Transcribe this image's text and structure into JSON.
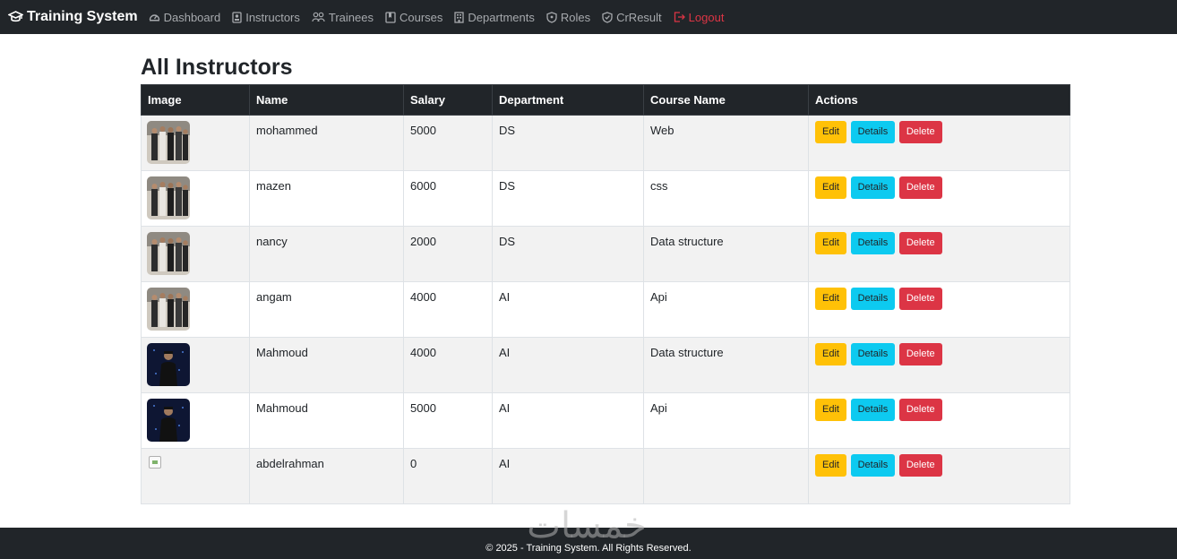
{
  "navbar": {
    "brand": "Training System",
    "items": [
      {
        "label": "Dashboard",
        "icon": "speedometer-icon"
      },
      {
        "label": "Instructors",
        "icon": "id-card-icon"
      },
      {
        "label": "Trainees",
        "icon": "people-icon"
      },
      {
        "label": "Courses",
        "icon": "book-icon"
      },
      {
        "label": "Departments",
        "icon": "building-icon"
      },
      {
        "label": "Roles",
        "icon": "shield-icon"
      },
      {
        "label": "CrResult",
        "icon": "shield-check-icon"
      },
      {
        "label": "Logout",
        "icon": "logout-icon"
      }
    ],
    "colors": {
      "background": "#212529",
      "link": "#a6a9ad",
      "logout": "#dc3545"
    }
  },
  "page": {
    "title": "All Instructors"
  },
  "table": {
    "headers": [
      "Image",
      "Name",
      "Salary",
      "Department",
      "Course Name",
      "Actions"
    ],
    "rows": [
      {
        "image": "group-photo",
        "name": "mohammed",
        "salary": "5000",
        "department": "DS",
        "course": "Web"
      },
      {
        "image": "group-photo",
        "name": "mazen",
        "salary": "6000",
        "department": "DS",
        "course": "css"
      },
      {
        "image": "group-photo",
        "name": "nancy",
        "salary": "2000",
        "department": "DS",
        "course": "Data structure"
      },
      {
        "image": "group-photo",
        "name": "angam",
        "salary": "4000",
        "department": "AI",
        "course": "Api"
      },
      {
        "image": "portrait-photo",
        "name": "Mahmoud",
        "salary": "4000",
        "department": "AI",
        "course": "Data structure"
      },
      {
        "image": "portrait-photo",
        "name": "Mahmoud",
        "salary": "5000",
        "department": "AI",
        "course": "Api"
      },
      {
        "image": "broken-image",
        "name": "abdelrahman",
        "salary": "0",
        "department": "AI",
        "course": ""
      }
    ],
    "actions": {
      "edit": "Edit",
      "details": "Details",
      "delete": "Delete"
    },
    "colors": {
      "edit": "#ffc107",
      "details": "#0dcaf0",
      "delete": "#dc3545"
    }
  },
  "footer": {
    "text": "© 2025 - Training System. All Rights Reserved."
  },
  "watermark": {
    "text": "خمسات"
  }
}
